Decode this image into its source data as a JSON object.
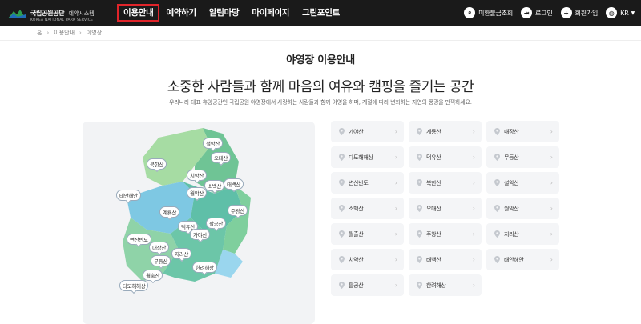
{
  "header": {
    "logo": {
      "main": "국립공원공단",
      "sub": "예약시스템",
      "en": "KOREA NATIONAL PARK SERVICE"
    },
    "nav": [
      {
        "label": "이용안내",
        "active": true
      },
      {
        "label": "예약하기"
      },
      {
        "label": "알림마당"
      },
      {
        "label": "마이페이지"
      },
      {
        "label": "그린포인트"
      }
    ],
    "util": [
      {
        "label": "미환불금조회",
        "icon": "search-doc-icon"
      },
      {
        "label": "로그인",
        "icon": "login-icon"
      },
      {
        "label": "회원가입",
        "icon": "user-add-icon"
      },
      {
        "label": "KR",
        "icon": "globe-icon"
      }
    ]
  },
  "breadcrumb": [
    "홈",
    "이용안내",
    "야영장"
  ],
  "page_title": "야영장 이용안내",
  "hero": {
    "title": "소중한 사람들과 함께 마음의 여유와 캠핑을 즐기는 공간",
    "desc": "우리나라 대표 휴양공간인 국립공원 야영장에서 사랑하는 사람들과 함께 야영을 하며, 계절에 따라 변화하는 자연의 풍광을 만끽하세요."
  },
  "map_labels": [
    "설악산",
    "북한산",
    "오대산",
    "치악산",
    "소백산",
    "태백산",
    "월악산",
    "태안해안",
    "계룡산",
    "주왕산",
    "덕유산",
    "가야산",
    "팔공산",
    "변산반도",
    "내장산",
    "지리산",
    "무등산",
    "한려해상",
    "월출산",
    "다도해해상"
  ],
  "parks": [
    "가야산",
    "계룡산",
    "내장산",
    "다도해해상",
    "덕유산",
    "무등산",
    "변산반도",
    "북한산",
    "설악산",
    "소백산",
    "오대산",
    "월악산",
    "월출산",
    "주왕산",
    "지리산",
    "치악산",
    "태백산",
    "태안해안",
    "팔공산",
    "한려해상"
  ],
  "colors": {
    "header_bg": "#1a1a1a",
    "active_border": "#e0242a",
    "map_green": "#7fcf9d",
    "map_teal": "#5fbfa8",
    "map_blue": "#7ec8e3"
  }
}
